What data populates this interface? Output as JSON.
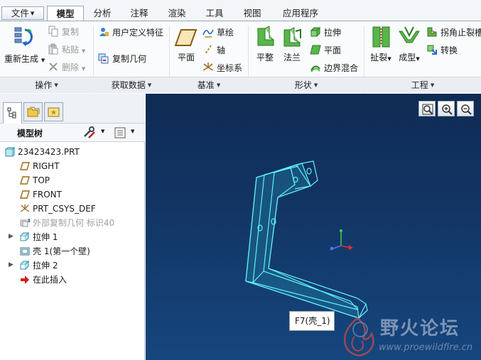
{
  "tabs": [
    {
      "label": "文件"
    },
    {
      "label": "模型"
    },
    {
      "label": "分析"
    },
    {
      "label": "注释"
    },
    {
      "label": "渲染"
    },
    {
      "label": "工具"
    },
    {
      "label": "视图"
    },
    {
      "label": "应用程序"
    }
  ],
  "ribbon": {
    "operations": {
      "title": "操作",
      "regenerate": "重新生成",
      "copy": "复制",
      "paste": "粘贴",
      "delete": "删除"
    },
    "get_data": {
      "title": "获取数据",
      "udf": "用户定义特征",
      "copy_geom": "复制几何"
    },
    "datum": {
      "title": "基准",
      "plane": "平面",
      "sketch": "草绘",
      "axis": "轴",
      "csys": "坐标系"
    },
    "shapes": {
      "title": "形状",
      "flat": "平整",
      "flange": "法兰",
      "extrude": "拉伸",
      "planar": "平面",
      "blend": "边界混合"
    },
    "engineering": {
      "title": "工程",
      "rip": "扯裂",
      "form": "成型",
      "corner_relief": "拐角止裂槽",
      "convert": "转换"
    }
  },
  "panel": {
    "tree_title": "模型树",
    "items": [
      {
        "label": "23423423.PRT"
      },
      {
        "label": "RIGHT"
      },
      {
        "label": "TOP"
      },
      {
        "label": "FRONT"
      },
      {
        "label": "PRT_CSYS_DEF"
      },
      {
        "label": "外部复制几何 标识40"
      },
      {
        "label": "拉伸 1"
      },
      {
        "label": "壳 1(第一个壁)"
      },
      {
        "label": "拉伸 2"
      },
      {
        "label": "在此插入"
      }
    ]
  },
  "viewport": {
    "tooltip": "F7(壳_1)"
  },
  "watermark": {
    "name": "野火论坛",
    "url": "www.proewildfire.cn"
  },
  "colors": {
    "viewport_top": "#0f2b54",
    "viewport_bottom": "#15467e",
    "model_edge": "#5ff0f5",
    "model_fill": "#1d6d96"
  }
}
